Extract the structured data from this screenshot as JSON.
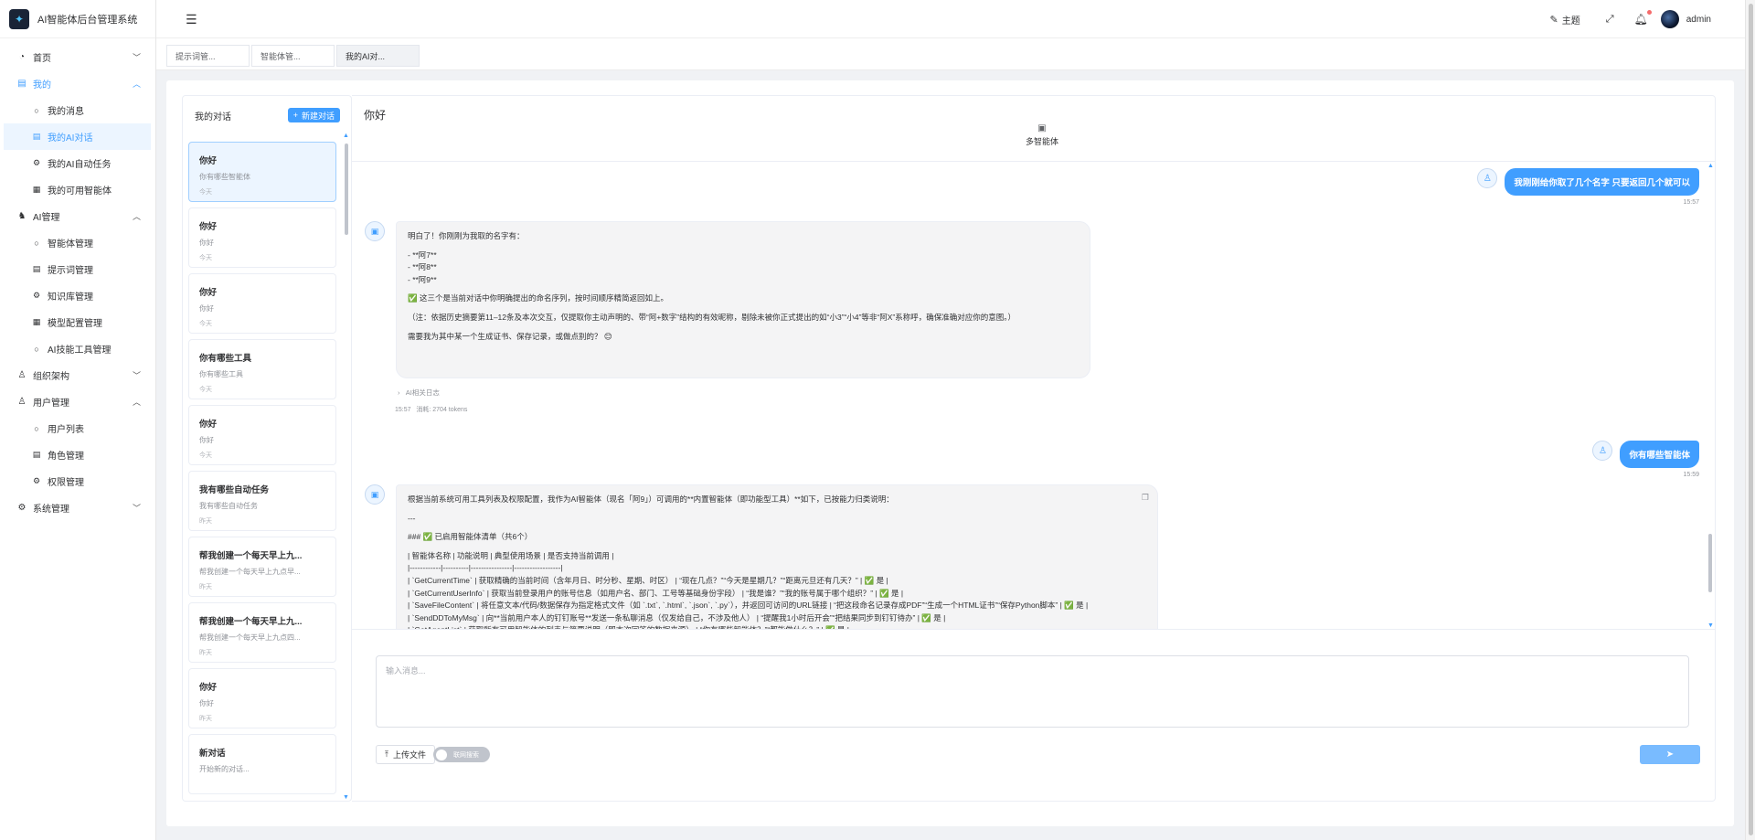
{
  "app": {
    "title": "AI智能体后台管理系统",
    "logo_icon": "robot-logo-icon"
  },
  "sidebar": {
    "menu": [
      {
        "label": "首页",
        "icon": "◔",
        "expanded": false
      },
      {
        "label": "我的",
        "icon": "▤",
        "expanded": true,
        "active": true,
        "children": [
          "我的消息",
          "我的AI对话",
          "我的AI自动任务",
          "我的可用智能体"
        ]
      },
      {
        "label": "AI管理",
        "icon": "♞",
        "expanded": true,
        "children": [
          "智能体管理",
          "提示词管理",
          "知识库管理",
          "模型配置管理",
          "AI技能工具管理"
        ]
      },
      {
        "label": "组织架构",
        "icon": "♙",
        "expanded": false
      },
      {
        "label": "用户管理",
        "icon": "♙",
        "expanded": true,
        "children": [
          "用户列表",
          "角色管理",
          "权限管理"
        ]
      },
      {
        "label": "系统管理",
        "icon": "⚙",
        "expanded": false
      }
    ],
    "selected_child": "我的AI对话"
  },
  "header": {
    "theme_label": "主题",
    "user_name": "admin",
    "notification_dot_color": "#f56c6c"
  },
  "tabs": [
    "提示词管...",
    "智能体管...",
    "我的AI对..."
  ],
  "active_tab": 2,
  "conversations": {
    "title": "我的对话",
    "new_button": "新建对话",
    "items": [
      {
        "title": "你好",
        "preview": "你有哪些智能体",
        "time": "今天"
      },
      {
        "title": "你好",
        "preview": "你好",
        "time": "今天"
      },
      {
        "title": "你好",
        "preview": "你好",
        "time": "今天"
      },
      {
        "title": "你有哪些工具",
        "preview": "你有哪些工具",
        "time": "今天"
      },
      {
        "title": "你好",
        "preview": "你好",
        "time": "今天"
      },
      {
        "title": "我有哪些自动任务",
        "preview": "我有哪些自动任务",
        "time": "昨天"
      },
      {
        "title": "帮我创建一个每天早上九...",
        "preview": "帮我创建一个每天早上九点早...",
        "time": "昨天"
      },
      {
        "title": "帮我创建一个每天早上九...",
        "preview": "帮我创建一个每天早上九点四...",
        "time": "昨天"
      },
      {
        "title": "你好",
        "preview": "你好",
        "time": "昨天"
      },
      {
        "title": "新对话",
        "preview": "开始新的对话...",
        "time": ""
      }
    ]
  },
  "chat": {
    "title": "你好",
    "agent_label": "多智能体",
    "messages": [
      {
        "role": "user",
        "text": "我刚刚给你取了几个名字 只要返回几个就可以",
        "time": "15:57"
      },
      {
        "role": "assistant",
        "lines": [
          "明白了！你刚刚为我取的名字有：",
          "",
          "- **阿7**",
          "- **阿8**",
          "- **阿9**",
          "",
          "✅ 这三个是当前对话中你明确提出的命名序列，按时间顺序精简返回如上。",
          "",
          "（注：依据历史摘要第11–12条及本次交互，仅提取你主动声明的、带“阿+数字”结构的有效昵称，剔除未被你正式提出的如“小3”“小4”等非“阿X”系称呼，确保准确对应你的意图。）",
          "",
          "需要我为其中某一个生成证书、保存记录，或做点别的？ 😊"
        ],
        "log_label": "AI相关日志",
        "time": "15:57",
        "tokens": "消耗: 2704 tokens"
      },
      {
        "role": "user",
        "text": "你有哪些智能体",
        "time": "15:59"
      },
      {
        "role": "assistant",
        "lines": [
          "根据当前系统可用工具列表及权限配置，我作为AI智能体（现名「阿9」）可调用的**内置智能体（即功能型工具）**如下，已按能力归类说明：",
          "",
          "---",
          "",
          "### ✅ 已启用智能体清单（共6个）",
          "",
          "| 智能体名称 | 功能说明 | 典型使用场景 | 是否支持当前调用 |",
          "|------------|----------|----------------|------------------|",
          "| `GetCurrentTime` | 获取精确的当前时间（含年月日、时分秒、星期、时区） | “现在几点？”“今天是星期几？”“距离元旦还有几天？” | ✅ 是 |",
          "| `GetCurrentUserInfo` | 获取当前登录用户的账号信息（如用户名、部门、工号等基础身份字段） | “我是谁？”“我的账号属于哪个组织？” | ✅ 是 |",
          "| `SaveFileContent` | 将任意文本/代码/数据保存为指定格式文件（如 `.txt`, `.html`, `.json`, `.py`），并返回可访问的URL链接 | “把这段命名记录存成PDF”“生成一个HTML证书”“保存Python脚本” | ✅ 是 |",
          "| `SendDDToMyMsg` | 向**当前用户本人的钉钉账号**发送一条私聊消息（仅发给自己，不涉及他人） | “提醒我1小时后开会”“把结果同步到钉钉待办” | ✅ 是 |",
          "| `GetAgentList` | 获取所有可用智能体的列表与简要说明（即本次回答的数据来源） | “你有哪些智能体？”“都能做什么？” | ✅ 是 |"
        ]
      }
    ]
  },
  "input": {
    "placeholder": "输入消息...",
    "upload_label": "上传文件",
    "web_search_label": "联网搜索"
  }
}
